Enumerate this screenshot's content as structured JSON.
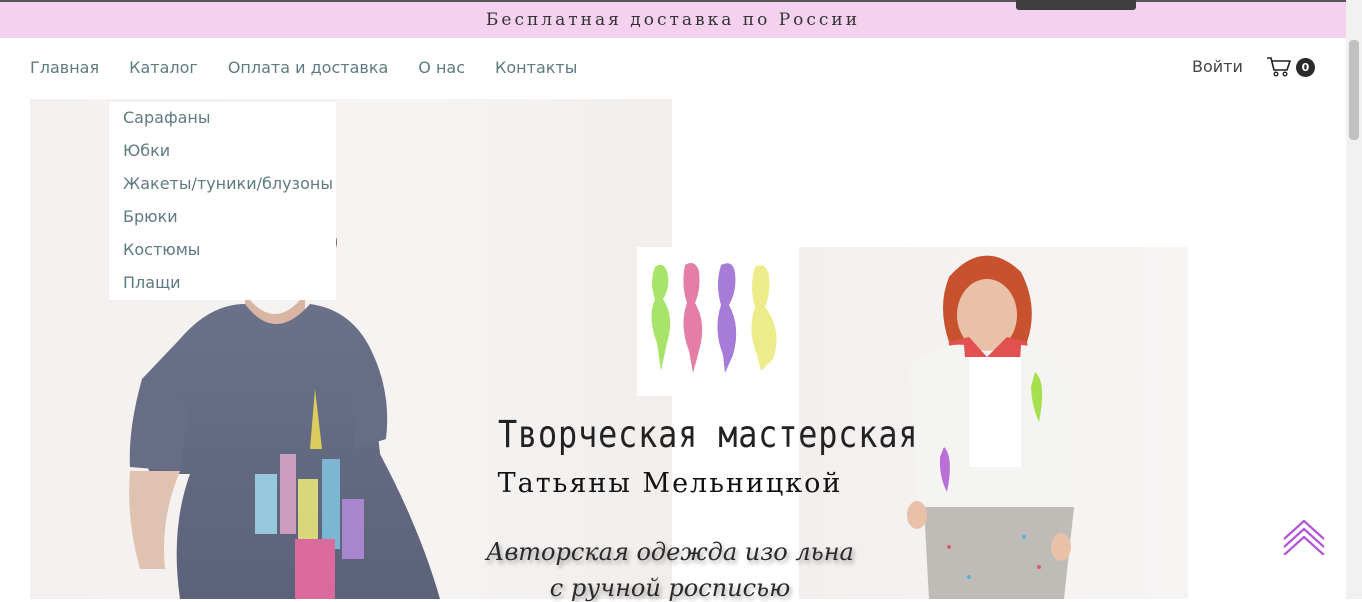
{
  "banner": {
    "text": "Бесплатная доставка по России"
  },
  "nav": {
    "items": [
      "Главная",
      "Каталог",
      "Оплата и доставка",
      "О нас",
      "Контакты"
    ]
  },
  "header": {
    "login": "Войти",
    "cart_count": "0"
  },
  "catalog_menu": {
    "items": [
      "Сарафаны",
      "Юбки",
      "Жакеты/туники/блузоны",
      "Брюки",
      "Костюмы",
      "Плащи"
    ]
  },
  "hero": {
    "title_line1": "Творческая мастерская",
    "title_line2": "Татьяны Мельницкой",
    "slogan_line1": "Авторская одежда изо льна",
    "slogan_line2": "с ручной росписью"
  },
  "logo": {
    "figure_colors": [
      "#a8e46a",
      "#e57ea6",
      "#a77bd8",
      "#ecec8a"
    ]
  },
  "icons": {
    "cart": "cart-icon",
    "scroll_up": "double-chevron-up-icon",
    "accent_color": "#b155d6"
  }
}
